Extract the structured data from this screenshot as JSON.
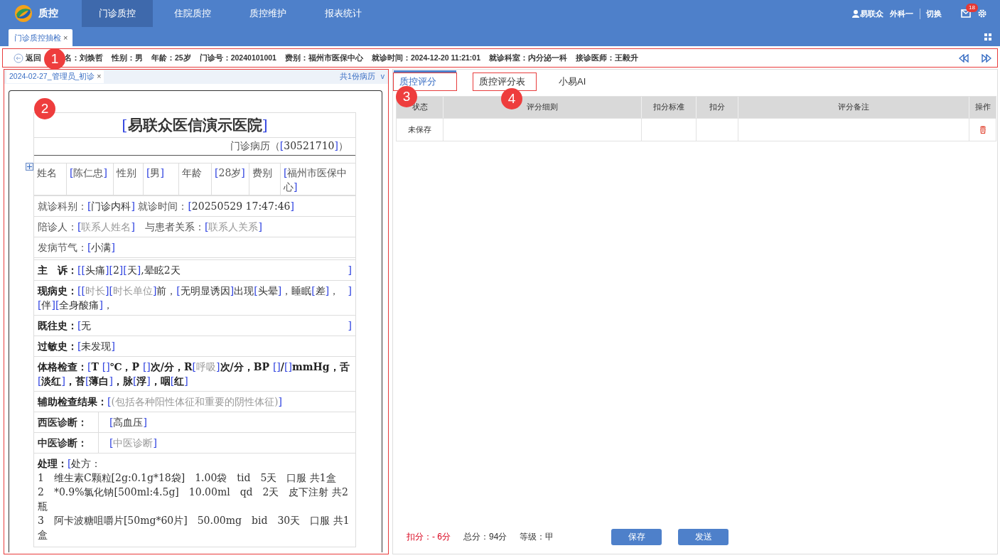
{
  "topbar": {
    "app_title": "质控",
    "nav": [
      {
        "label": "门诊质控",
        "selected": true
      },
      {
        "label": "住院质控",
        "selected": false
      },
      {
        "label": "质控维护",
        "selected": false
      },
      {
        "label": "报表统计",
        "selected": false
      }
    ],
    "user": "易联众",
    "dept": "外科一",
    "switch": "切换",
    "mail_badge": "18"
  },
  "page_tabs": [
    {
      "label": "门诊质控抽检",
      "close": "×",
      "selected": true
    }
  ],
  "patient_bar": {
    "highlighted": true,
    "callout": "1",
    "back": "返回",
    "fields": [
      {
        "label": "名：",
        "value": "刘焕哲"
      },
      {
        "label": "性别：",
        "value": "男"
      },
      {
        "label": "年龄：",
        "value": "25岁"
      },
      {
        "label": "门诊号：",
        "value": "20240101001"
      },
      {
        "label": "费别：",
        "value": "福州市医保中心"
      },
      {
        "label": "就诊时间：",
        "value": "2024-12-20 11:21:01"
      },
      {
        "label": "就诊科室：",
        "value": "内分泌一科"
      },
      {
        "label": "接诊医师：",
        "value": "王毅升"
      }
    ]
  },
  "record_panel": {
    "highlighted": true,
    "tabs": [
      {
        "label": "2024-02-27_管理员_初诊",
        "close": "×",
        "selected": true
      }
    ],
    "record_count": "共1份病历",
    "dropdown": "v",
    "document": {
      "callout": "2",
      "title": [
        {
          "kind": "bracket",
          "text": "["
        },
        {
          "kind": "value",
          "text": "易联众医信演示医院"
        },
        {
          "kind": "bracket",
          "text": "]"
        }
      ],
      "subtitle": [
        {
          "kind": "text",
          "text": "门诊病历（"
        },
        {
          "kind": "bracket",
          "text": "["
        },
        {
          "kind": "value",
          "text": "30521710"
        },
        {
          "kind": "bracket",
          "text": "]"
        },
        {
          "kind": "text",
          "text": "）"
        }
      ],
      "info_cells": [
        [
          {
            "kind": "text",
            "text": "姓名"
          }
        ],
        [
          {
            "kind": "bracket",
            "text": "["
          },
          {
            "kind": "text",
            "text": "陈仁忠"
          },
          {
            "kind": "bracket",
            "text": "]"
          }
        ],
        [
          {
            "kind": "text",
            "text": "性别"
          }
        ],
        [
          {
            "kind": "bracket",
            "text": "["
          },
          {
            "kind": "text",
            "text": "男"
          },
          {
            "kind": "bracket",
            "text": "]"
          }
        ],
        [
          {
            "kind": "text",
            "text": "年龄"
          }
        ],
        [
          {
            "kind": "bracket",
            "text": "["
          },
          {
            "kind": "text",
            "text": "28岁"
          },
          {
            "kind": "bracket",
            "text": "]"
          }
        ],
        [
          {
            "kind": "text",
            "text": "费别"
          }
        ],
        [
          {
            "kind": "bracket",
            "text": "["
          },
          {
            "kind": "text",
            "text": "福州市医保中心"
          },
          {
            "kind": "bracket",
            "text": "]"
          }
        ]
      ],
      "sections": [
        {
          "rows": [
            {
              "kind": "line",
              "segments": [
                {
                  "kind": "text",
                  "text": "就诊科别："
                },
                {
                  "kind": "bracket",
                  "text": "["
                },
                {
                  "kind": "value",
                  "text": "门诊内科"
                },
                {
                  "kind": "bracket",
                  "text": "]"
                },
                {
                  "kind": "text",
                  "text": " 就诊时间："
                },
                {
                  "kind": "bracket",
                  "text": "["
                },
                {
                  "kind": "value",
                  "text": "20250529 17:47:46"
                },
                {
                  "kind": "bracket",
                  "text": "]"
                }
              ]
            },
            {
              "kind": "line",
              "segments": [
                {
                  "kind": "text",
                  "text": "陪诊人："
                },
                {
                  "kind": "bracket",
                  "text": "["
                },
                {
                  "kind": "hint",
                  "text": "联系人姓名"
                },
                {
                  "kind": "bracket",
                  "text": "]"
                },
                {
                  "kind": "text",
                  "text": "　与患者关系："
                },
                {
                  "kind": "bracket",
                  "text": "["
                },
                {
                  "kind": "hint",
                  "text": "联系人关系"
                },
                {
                  "kind": "bracket",
                  "text": "]"
                }
              ]
            },
            {
              "kind": "line",
              "segments": [
                {
                  "kind": "text",
                  "text": "发病节气："
                },
                {
                  "kind": "bracket",
                  "text": "["
                },
                {
                  "kind": "value",
                  "text": "小满"
                },
                {
                  "kind": "bracket",
                  "text": "]"
                }
              ]
            }
          ]
        },
        {
          "rows": [
            {
              "kind": "line",
              "closing": "]",
              "segments": [
                {
                  "kind": "label",
                  "text": "主　诉："
                },
                {
                  "kind": "bracket",
                  "text": "[["
                },
                {
                  "kind": "value",
                  "text": "头痛"
                },
                {
                  "kind": "bracket",
                  "text": "]["
                },
                {
                  "kind": "value",
                  "text": "2"
                },
                {
                  "kind": "bracket",
                  "text": "]["
                },
                {
                  "kind": "value",
                  "text": "天"
                },
                {
                  "kind": "bracket",
                  "text": "]"
                },
                {
                  "kind": "value",
                  "text": ",晕眩2天"
                }
              ]
            },
            {
              "kind": "line",
              "closing": "]",
              "segments": [
                {
                  "kind": "label",
                  "text": "现病史："
                },
                {
                  "kind": "bracket",
                  "text": "[["
                },
                {
                  "kind": "hint",
                  "text": "时长"
                },
                {
                  "kind": "bracket",
                  "text": "]["
                },
                {
                  "kind": "hint",
                  "text": "时长单位"
                },
                {
                  "kind": "bracket",
                  "text": "]"
                },
                {
                  "kind": "value",
                  "text": "前，"
                },
                {
                  "kind": "bracket",
                  "text": "["
                },
                {
                  "kind": "value",
                  "text": "无明显诱因"
                },
                {
                  "kind": "bracket",
                  "text": "]"
                },
                {
                  "kind": "value",
                  "text": "出现"
                },
                {
                  "kind": "bracket",
                  "text": "["
                },
                {
                  "kind": "value",
                  "text": "头晕"
                },
                {
                  "kind": "bracket",
                  "text": "]"
                },
                {
                  "kind": "value",
                  "text": "，睡眠"
                },
                {
                  "kind": "bracket",
                  "text": "["
                },
                {
                  "kind": "value",
                  "text": "差"
                },
                {
                  "kind": "bracket",
                  "text": "]"
                },
                {
                  "kind": "value",
                  "text": "，"
                },
                {
                  "kind": "bracket",
                  "text": "["
                },
                {
                  "kind": "value",
                  "text": "伴"
                },
                {
                  "kind": "bracket",
                  "text": "]["
                },
                {
                  "kind": "value",
                  "text": "全身酸痛"
                },
                {
                  "kind": "bracket",
                  "text": "]"
                },
                {
                  "kind": "value",
                  "text": "，"
                }
              ]
            },
            {
              "kind": "line",
              "closing": "]",
              "segments": [
                {
                  "kind": "label",
                  "text": "既往史："
                },
                {
                  "kind": "bracket",
                  "text": "["
                },
                {
                  "kind": "value",
                  "text": "无"
                }
              ]
            },
            {
              "kind": "line",
              "segments": [
                {
                  "kind": "label",
                  "text": "过敏史："
                },
                {
                  "kind": "bracket",
                  "text": "["
                },
                {
                  "kind": "value",
                  "text": "未发现"
                },
                {
                  "kind": "bracket",
                  "text": "]"
                }
              ]
            },
            {
              "kind": "line",
              "segments": [
                {
                  "kind": "label",
                  "text": "体格检查："
                },
                {
                  "kind": "bracket",
                  "text": "["
                },
                {
                  "kind": "bold",
                  "text": "T "
                },
                {
                  "kind": "bracket",
                  "text": "[]"
                },
                {
                  "kind": "bold",
                  "text": "℃，P "
                },
                {
                  "kind": "bracket",
                  "text": "[]"
                },
                {
                  "kind": "bold",
                  "text": "次/分，R"
                },
                {
                  "kind": "bracket",
                  "text": "["
                },
                {
                  "kind": "hint",
                  "text": "呼吸"
                },
                {
                  "kind": "bracket",
                  "text": "]"
                },
                {
                  "kind": "bold",
                  "text": "次/分，BP "
                },
                {
                  "kind": "bracket",
                  "text": "[]"
                },
                {
                  "kind": "bold",
                  "text": "/"
                },
                {
                  "kind": "bracket",
                  "text": "[]"
                },
                {
                  "kind": "bold",
                  "text": "mmHg，舌"
                },
                {
                  "kind": "bracket",
                  "text": "["
                },
                {
                  "kind": "bold",
                  "text": "淡红"
                },
                {
                  "kind": "bracket",
                  "text": "]"
                },
                {
                  "kind": "bold",
                  "text": "，苔"
                },
                {
                  "kind": "bracket",
                  "text": "["
                },
                {
                  "kind": "bold",
                  "text": "薄白"
                },
                {
                  "kind": "bracket",
                  "text": "]"
                },
                {
                  "kind": "bold",
                  "text": "，脉"
                },
                {
                  "kind": "bracket",
                  "text": "["
                },
                {
                  "kind": "bold",
                  "text": "浮"
                },
                {
                  "kind": "bracket",
                  "text": "]"
                },
                {
                  "kind": "bold",
                  "text": "，咽"
                },
                {
                  "kind": "bracket",
                  "text": "["
                },
                {
                  "kind": "bold",
                  "text": "红"
                },
                {
                  "kind": "bracket",
                  "text": "]"
                }
              ]
            },
            {
              "kind": "line",
              "segments": [
                {
                  "kind": "label",
                  "text": "辅助检查结果："
                },
                {
                  "kind": "bracket",
                  "text": "["
                },
                {
                  "kind": "hint",
                  "text": "(包括各种阳性体征和重要的阴性体征)"
                },
                {
                  "kind": "bracket",
                  "text": "]"
                }
              ]
            },
            {
              "kind": "split",
              "label": "西医诊断：",
              "segments": [
                {
                  "kind": "bracket",
                  "text": "["
                },
                {
                  "kind": "value",
                  "text": "高血压"
                },
                {
                  "kind": "bracket",
                  "text": "]"
                }
              ]
            },
            {
              "kind": "split",
              "label": "中医诊断：",
              "segments": [
                {
                  "kind": "bracket",
                  "text": "["
                },
                {
                  "kind": "hint",
                  "text": "中医诊断"
                },
                {
                  "kind": "bracket",
                  "text": "]"
                }
              ]
            },
            {
              "kind": "tall",
              "segments": [
                {
                  "kind": "label",
                  "text": "处理："
                },
                {
                  "kind": "bracket",
                  "text": "["
                },
                {
                  "kind": "value",
                  "text": "处方：\n1　维生素C颗粒[2g:0.1g*18袋]　1.00袋　tid　5天　口服 共1盒\n2　*0.9%氯化钠[500ml:4.5g]　10.00ml　qd　2天　皮下注射 共2瓶\n3　阿卡波糖咀嚼片[50mg*60片]　50.00mg　bid　30天　口服 共1盒"
                }
              ]
            }
          ]
        }
      ]
    }
  },
  "score_panel": {
    "tabs": [
      {
        "label": "质控评分",
        "selected": true,
        "highlighted": true,
        "callout": "3"
      },
      {
        "label": "质控评分表",
        "selected": false,
        "highlighted": true,
        "callout": "4"
      },
      {
        "label": "小易AI",
        "selected": false,
        "highlighted": false
      }
    ],
    "table": {
      "columns": [
        "状态",
        "评分细则",
        "扣分标准",
        "扣分",
        "评分备注",
        "操作"
      ],
      "rows": [
        {
          "status": "未保存"
        }
      ]
    },
    "summary": {
      "deduction": "扣分：- 6分",
      "total": "总分：94分",
      "grade": "等级：甲"
    },
    "buttons": [
      "保存",
      "发送"
    ]
  }
}
